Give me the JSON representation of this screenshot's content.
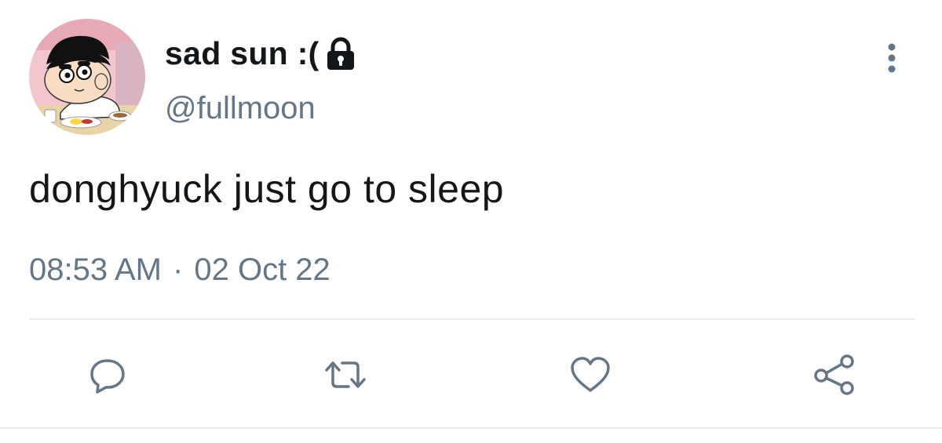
{
  "tweet": {
    "display_name": "sad sun :(",
    "handle": "@fullmoon",
    "text": "donghyuck just go to sleep",
    "time": "08:53 AM",
    "separator": "·",
    "date": "02 Oct 22",
    "protected_icon": "lock-icon",
    "more_icon": "more-vertical-icon"
  },
  "actions": [
    {
      "name": "reply",
      "icon": "reply-icon"
    },
    {
      "name": "retweet",
      "icon": "retweet-icon"
    },
    {
      "name": "like",
      "icon": "heart-icon"
    },
    {
      "name": "share",
      "icon": "share-icon"
    }
  ],
  "colors": {
    "text": "#14171a",
    "secondary": "#657786",
    "divider": "#e6ecf0"
  }
}
